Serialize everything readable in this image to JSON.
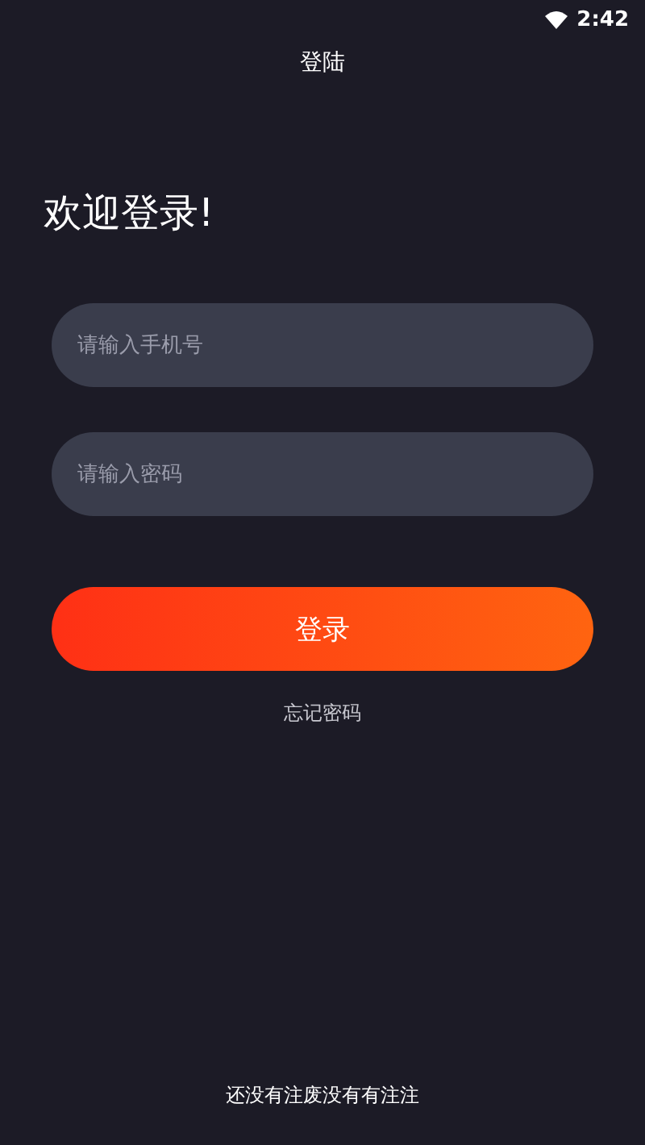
{
  "status_bar": {
    "time": "2:42"
  },
  "header": {
    "title": "登陆"
  },
  "welcome": "欢迎登录!",
  "fields": [
    {
      "placeholder": "请输入手机号"
    },
    {
      "placeholder": "请输入密码"
    }
  ],
  "login_button": "登录",
  "forgot_link": "忘记密码",
  "footer": "还没有注废没有有注注"
}
